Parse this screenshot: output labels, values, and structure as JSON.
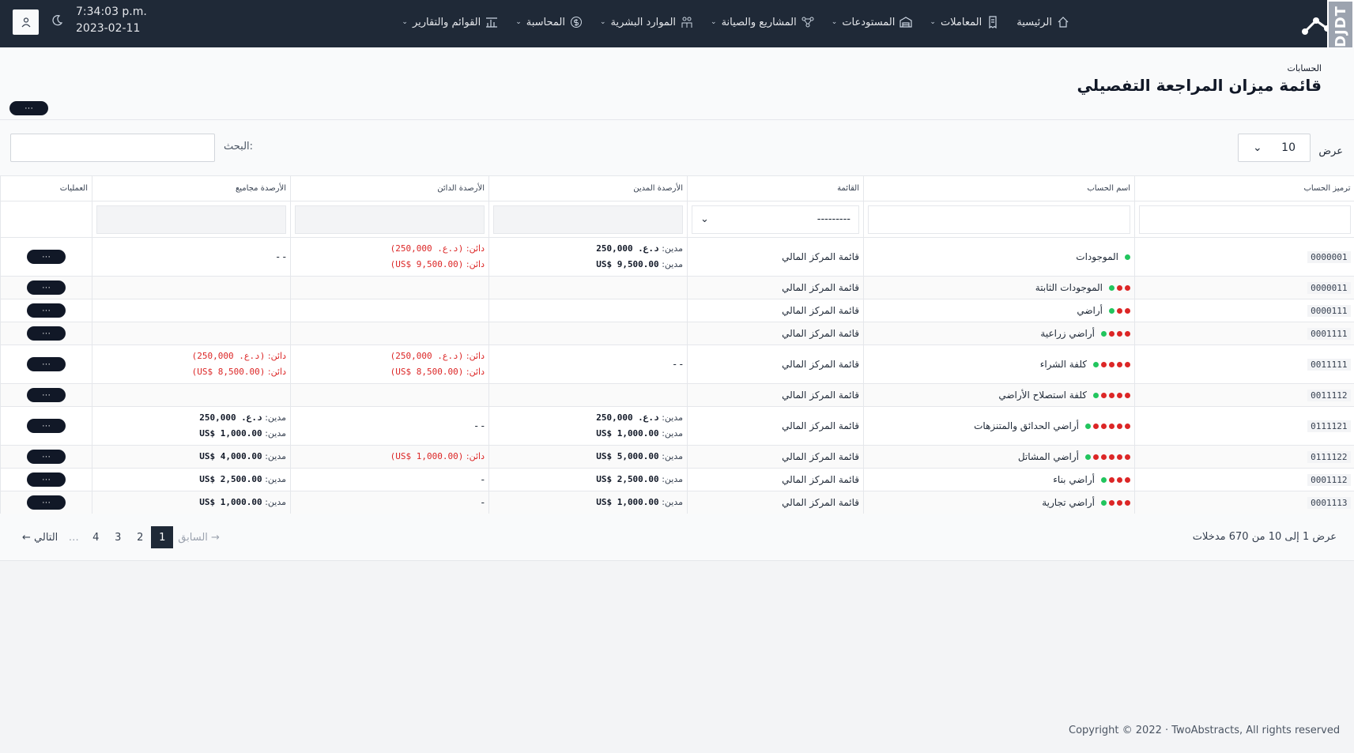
{
  "nav": {
    "clock_time": "7:34:03 p.m.",
    "clock_date": "2023-02-11",
    "djdt": "DJDT",
    "items": [
      {
        "label": "الرئيسية",
        "icon": "home-icon",
        "dropdown": false
      },
      {
        "label": "المعاملات",
        "icon": "receipt-icon",
        "dropdown": true
      },
      {
        "label": "المستودعات",
        "icon": "warehouse-icon",
        "dropdown": true
      },
      {
        "label": "المشاريع والصيانة",
        "icon": "network-icon",
        "dropdown": true
      },
      {
        "label": "الموارد البشرية",
        "icon": "people-icon",
        "dropdown": true
      },
      {
        "label": "المحاسبة",
        "icon": "dollar-icon",
        "dropdown": true
      },
      {
        "label": "القوائم والتقارير",
        "icon": "chart-icon",
        "dropdown": true
      }
    ]
  },
  "header": {
    "breadcrumb": "الحسابات",
    "title": "قائمة ميزان المراجعة التفصيلي",
    "action_label": "···"
  },
  "controls": {
    "show_label": "عرض",
    "show_value": "10",
    "search_label": "البحث:"
  },
  "table": {
    "columns": [
      "ترميز الحساب",
      "اسم الحساب",
      "القائمة",
      "الأرصدة المدين",
      "الأرصدة الدائن",
      "الأرصدة مجاميع",
      "العمليات"
    ],
    "filter_select": "---------",
    "op_label": "···",
    "rows": [
      {
        "code": "0000001",
        "name": "الموجودات",
        "red": 0,
        "list": "قائمة المركز المالي",
        "debit": [
          [
            "مدين:",
            "د.ع. 250,000"
          ],
          [
            "مدين:",
            "US$ 9,500.00"
          ]
        ],
        "debit_dash": "",
        "credit": [
          [
            "دائن:",
            "(د.ع. 250,000)"
          ],
          [
            "دائن:",
            "(US$ 9,500.00)"
          ]
        ],
        "credit_dash": "",
        "total": [],
        "total_cr": false,
        "total_dash": "- -"
      },
      {
        "code": "0000011",
        "name": "الموجودات الثابتة",
        "red": 2,
        "list": "قائمة المركز المالي",
        "debit": [],
        "debit_dash": "",
        "credit": [],
        "credit_dash": "",
        "total": [],
        "total_cr": false,
        "total_dash": ""
      },
      {
        "code": "0000111",
        "name": "أراضي",
        "red": 2,
        "list": "قائمة المركز المالي",
        "debit": [],
        "debit_dash": "",
        "credit": [],
        "credit_dash": "",
        "total": [],
        "total_cr": false,
        "total_dash": ""
      },
      {
        "code": "0001111",
        "name": "أراضي زراعية",
        "red": 3,
        "list": "قائمة المركز المالي",
        "debit": [],
        "debit_dash": "",
        "credit": [],
        "credit_dash": "",
        "total": [],
        "total_cr": false,
        "total_dash": ""
      },
      {
        "code": "0011111",
        "name": "كلفة الشراء",
        "red": 4,
        "list": "قائمة المركز المالي",
        "debit": [],
        "debit_dash": "- -",
        "credit": [
          [
            "دائن:",
            "(د.ع. 250,000)"
          ],
          [
            "دائن:",
            "(US$ 8,500.00)"
          ]
        ],
        "credit_dash": "",
        "total": [
          [
            "دائن:",
            "(د.ع. 250,000)"
          ],
          [
            "دائن:",
            "(US$ 8,500.00)"
          ]
        ],
        "total_cr": true,
        "total_dash": ""
      },
      {
        "code": "0011112",
        "name": "كلفة استصلاح الأراضي",
        "red": 4,
        "list": "قائمة المركز المالي",
        "debit": [],
        "debit_dash": "",
        "credit": [],
        "credit_dash": "",
        "total": [],
        "total_cr": false,
        "total_dash": ""
      },
      {
        "code": "0111121",
        "name": "أراضي الحدائق والمتنزهات",
        "red": 5,
        "list": "قائمة المركز المالي",
        "debit": [
          [
            "مدين:",
            "د.ع. 250,000"
          ],
          [
            "مدين:",
            "US$ 1,000.00"
          ]
        ],
        "debit_dash": "",
        "credit": [],
        "credit_dash": "- -",
        "total": [
          [
            "مدين:",
            "د.ع. 250,000"
          ],
          [
            "مدين:",
            "US$ 1,000.00"
          ]
        ],
        "total_cr": false,
        "total_dash": ""
      },
      {
        "code": "0111122",
        "name": "أراضي المشاتل",
        "red": 5,
        "list": "قائمة المركز المالي",
        "debit": [
          [
            "مدين:",
            "US$ 5,000.00"
          ]
        ],
        "debit_dash": "",
        "credit": [
          [
            "دائن:",
            "(US$ 1,000.00)"
          ]
        ],
        "credit_dash": "",
        "total": [
          [
            "مدين:",
            "US$ 4,000.00"
          ]
        ],
        "total_cr": false,
        "total_dash": ""
      },
      {
        "code": "0001112",
        "name": "أراضي بناء",
        "red": 3,
        "list": "قائمة المركز المالي",
        "debit": [
          [
            "مدين:",
            "US$ 2,500.00"
          ]
        ],
        "debit_dash": "",
        "credit": [],
        "credit_dash": "-",
        "total": [
          [
            "مدين:",
            "US$ 2,500.00"
          ]
        ],
        "total_cr": false,
        "total_dash": ""
      },
      {
        "code": "0001113",
        "name": "أراضي تجارية",
        "red": 3,
        "list": "قائمة المركز المالي",
        "debit": [
          [
            "مدين:",
            "US$ 1,000.00"
          ]
        ],
        "debit_dash": "",
        "credit": [],
        "credit_dash": "-",
        "total": [
          [
            "مدين:",
            "US$ 1,000.00"
          ]
        ],
        "total_cr": false,
        "total_dash": ""
      }
    ]
  },
  "pagination": {
    "entries_text": "عرض 1 إلى 10 من 670 مدخلات",
    "prev": "السابق",
    "next": "التالي",
    "pages": [
      "1",
      "2",
      "3",
      "4"
    ],
    "ellipsis": "…",
    "active": "1"
  },
  "footer": {
    "copyright": "Copyright © 2022  ·  TwoAbstracts, All rights reserved"
  },
  "colors": {
    "accent": "#1f2937",
    "credit": "#dc2626",
    "active_dot": "#22c55e"
  }
}
